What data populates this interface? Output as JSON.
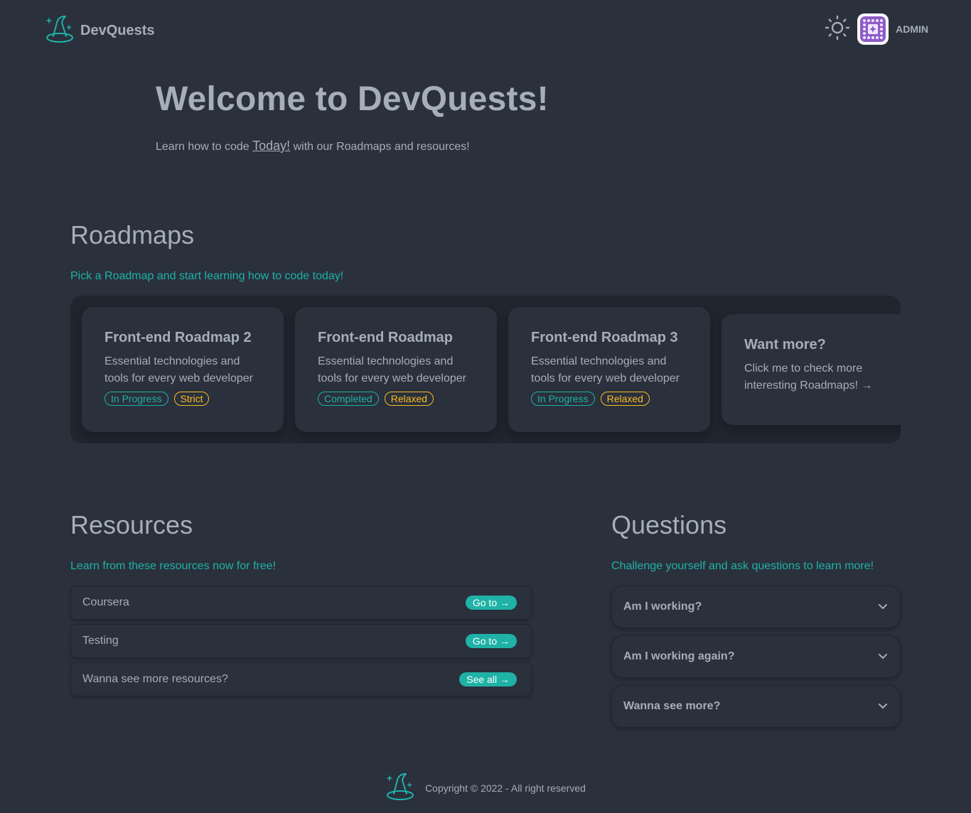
{
  "navbar": {
    "brand": "DevQuests",
    "user_label": "ADMIN",
    "icons": {
      "logo": "wizard-hat-icon",
      "theme": "sun-icon"
    }
  },
  "hero": {
    "title": "Welcome to DevQuests!",
    "subtitle_before": "Learn how to code",
    "subtitle_link": "Today!",
    "subtitle_after": "with our Roadmaps and resources!"
  },
  "roadmaps": {
    "title": "Roadmaps",
    "subtitle": "Pick a Roadmap and start learning how to code today!",
    "cards": [
      {
        "title": "Front-end Roadmap 2",
        "description": "Essential technologies and tools for every web developer",
        "status": "In Progress",
        "mode": "Strict"
      },
      {
        "title": "Front-end Roadmap",
        "description": "Essential technologies and tools for every web developer",
        "status": "Completed",
        "mode": "Relaxed"
      },
      {
        "title": "Front-end Roadmap 3",
        "description": "Essential technologies and tools for every web developer",
        "status": "In Progress",
        "mode": "Relaxed"
      }
    ],
    "more": {
      "title": "Want more?",
      "description": "Click me to check more interesting Roadmaps! →"
    }
  },
  "resources": {
    "title": "Resources",
    "subtitle": "Learn from these resources now for free!",
    "items": [
      {
        "label": "Coursera",
        "button": "Go to →"
      },
      {
        "label": "Testing",
        "button": "Go to →"
      },
      {
        "label": "Wanna see more resources?",
        "button": "See all →"
      }
    ]
  },
  "questions": {
    "title": "Questions",
    "subtitle": "Challenge yourself and ask questions to learn more!",
    "items": [
      {
        "label": "Am I working?"
      },
      {
        "label": "Am I working again?"
      },
      {
        "label": "Wanna see more?"
      }
    ]
  },
  "footer": {
    "text": "Copyright © 2022 - All right reserved"
  },
  "colors": {
    "background": "#2a303c",
    "accent": "#1fb2a6",
    "warning": "#fbbd23",
    "text": "#a6adbb",
    "surface_dark": "#20252e"
  }
}
